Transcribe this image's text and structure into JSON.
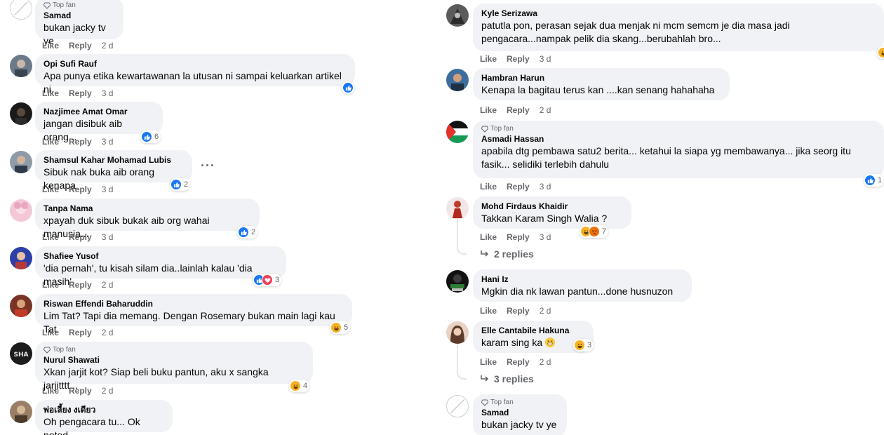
{
  "common": {
    "like": "Like",
    "reply": "Reply",
    "top_fan": "Top fan"
  },
  "colors": {
    "bubble": "#f0f2f5",
    "meta": "#65676b",
    "like": "#1877f2",
    "love": "#f33e58",
    "haha": "#f7b125"
  },
  "left": [
    {
      "author": "Samad",
      "text": "bukan jacky tv ye",
      "time": "2 d",
      "top_fan": true
    },
    {
      "author": "Opi Sufi Rauf",
      "text": "Apa punya etika kewartawanan la utusan ni sampai keluarkan artikel ni.",
      "time": "3 d",
      "reactions": [
        "like"
      ],
      "count": ""
    },
    {
      "author": "Nazjimee Amat Omar",
      "text": "jangan disibuk aib orang...",
      "time": "3 d",
      "reactions": [
        "like"
      ],
      "count": "6"
    },
    {
      "author": "Shamsul Kahar Mohamad Lubis",
      "text": "Sibuk nak buka aib orang kenapa",
      "time": "3 d",
      "reactions": [
        "like"
      ],
      "count": "2"
    },
    {
      "author": "Tanpa Nama",
      "text": "xpayah duk sibuk bukak aib org wahai manusia...",
      "time": "3 d",
      "reactions": [
        "like"
      ],
      "count": "2"
    },
    {
      "author": "Shafiee Yusof",
      "text": "'dia pernah', tu kisah silam dia..lainlah kalau 'dia masih'",
      "time": "2 d",
      "reactions": [
        "like",
        "love"
      ],
      "count": "3"
    },
    {
      "author": "Riswan Effendi Baharuddin",
      "text": "Lim Tat? Tapi dia memang. Dengan Rosemary bukan main lagi kau Tat.",
      "time": "2 d",
      "reactions": [
        "haha"
      ],
      "count": "5"
    },
    {
      "author": "Nurul Shawati",
      "text": "Xkan jarjit kot? Siap beli buku pantun, aku x sangka jarjitttt...",
      "time": "2 d",
      "top_fan": true,
      "reactions": [
        "haha"
      ],
      "count": "4"
    },
    {
      "author": "พ่อเลี้ยง งเดียว",
      "text": "Oh pengacara tu... Ok noted."
    }
  ],
  "right": [
    {
      "author": "Kyle Serizawa",
      "text1": "patutla pon, perasan sejak dua menjak ni mcm semcm je dia masa jadi",
      "text2": "pengacara...nampak pelik dia skang...berubahlah bro...",
      "time": "3 d"
    },
    {
      "author": "Hambran Harun",
      "text1": "Kenapa la bagitau terus kan ....kan senang hahahaha",
      "time": "2 d"
    },
    {
      "author": "Asmadi Hassan",
      "top_fan": true,
      "text1": "apabila dtg pembawa satu2 berita... ketahui la siapa yg membawanya... jika seorg itu",
      "text2": "fasik... selidiki terlebih dahulu",
      "time": "3 d",
      "count": "1"
    },
    {
      "author": "Mohd Firdaus Khaidir",
      "text1": "Takkan Karam Singh Walia ?",
      "time": "3 d",
      "count": "7",
      "replies": "2 replies"
    },
    {
      "author": "Hani Iz",
      "text1": "Mgkin dia nk lawan pantun...done husnuzon",
      "time": "2 d"
    },
    {
      "author": "Elle Cantabile Hakuna",
      "text1": "karam sing ka",
      "time": "2 d",
      "count": "3",
      "replies": "3 replies"
    },
    {
      "author": "Samad",
      "top_fan": true,
      "text1": "bukan jacky tv ye"
    }
  ]
}
